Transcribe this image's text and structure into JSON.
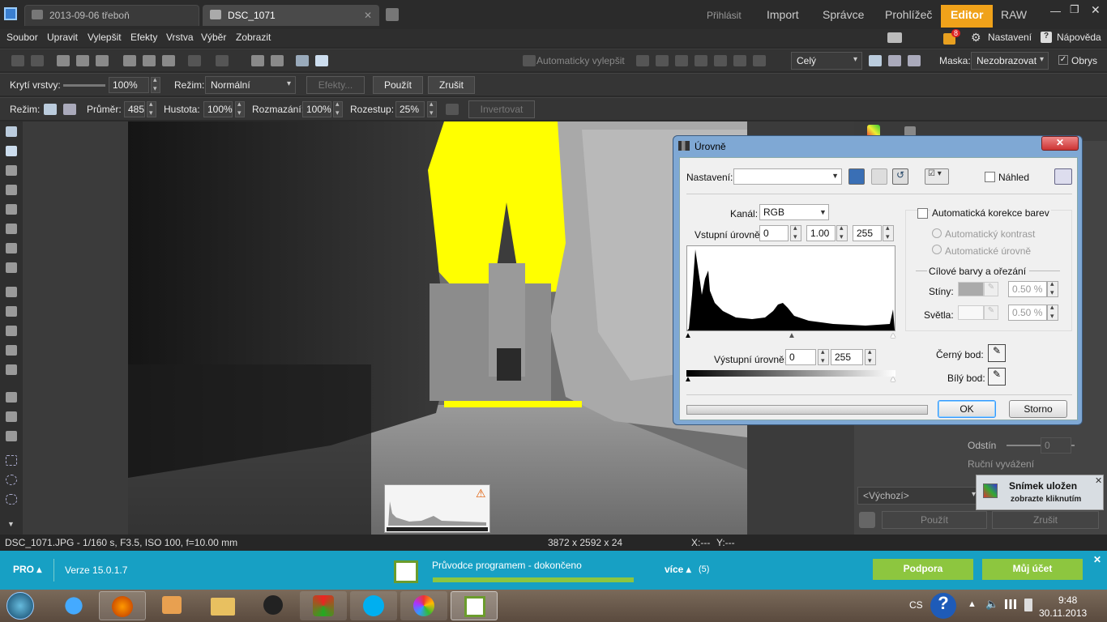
{
  "tabs": [
    {
      "label": "2013-09-06 třeboň"
    },
    {
      "label": "DSC_1071"
    }
  ],
  "nav": {
    "signin": "Přihlásit",
    "import": "Import",
    "manager": "Správce",
    "viewer": "Prohlížeč",
    "editor": "Editor",
    "raw": "RAW"
  },
  "menu": {
    "items": [
      "Soubor",
      "Upravit",
      "Vylepšit",
      "Efekty",
      "Vrstva",
      "Výběr",
      "Zobrazit"
    ],
    "badge": "8",
    "settings": "Nastavení",
    "help": "Nápověda"
  },
  "toolbar1": {
    "autoenhance": "Automaticky vylepšit",
    "zoom": "Celý",
    "mask_label": "Maska:",
    "mask_value": "Nezobrazovat",
    "outline": "Obrys"
  },
  "toolbar2": {
    "opacity_label": "Krytí vrstvy:",
    "opacity": "100%",
    "mode_label": "Režim:",
    "mode": "Normální",
    "effects": "Efekty...",
    "apply": "Použít",
    "cancel": "Zrušit"
  },
  "toolbar3": {
    "mode_label": "Režim:",
    "diameter_label": "Průměr:",
    "diameter": "485",
    "density_label": "Hustota:",
    "density": "100%",
    "blur_label": "Rozmazání:",
    "blur": "100%",
    "spacing_label": "Rozestup:",
    "spacing": "25%",
    "invert": "Invertovat"
  },
  "status": {
    "file": "DSC_1071.JPG - 1/160 s, F3.5, ISO 100, f=10.00 mm",
    "dimensions": "3872 x 2592 x 24",
    "x": "X:---",
    "y": "Y:---"
  },
  "probar": {
    "pro": "PRO",
    "version": "Verze 15.0.1.7",
    "wizard": "Průvodce programem - dokončeno",
    "wizard_progress": 1.0,
    "more": "více",
    "more_count": "(5)",
    "support": "Podpora",
    "account": "Můj účet"
  },
  "taskbar": {
    "lang": "CS",
    "time": "9:48",
    "date": "30.11.2013"
  },
  "notification": {
    "title": "Snímek uložen",
    "subtitle": "zobrazte kliknutím"
  },
  "rightpanel": {
    "hue": "Odstín",
    "hue_value": "0",
    "manual_balance": "Ruční vyvážení",
    "preset": "<Výchozí>",
    "apply": "Použít",
    "cancel": "Zrušit"
  },
  "dialog": {
    "title": "Úrovně",
    "preset_label": "Nastavení:",
    "preview": "Náhled",
    "channel_label": "Kanál:",
    "channel": "RGB",
    "input_label": "Vstupní úrovně:",
    "input_black": "0",
    "input_gamma": "1.00",
    "input_white": "255",
    "output_label": "Výstupní úrovně:",
    "output_black": "0",
    "output_white": "255",
    "auto_color": "Automatická korekce barev",
    "auto_contrast": "Automatický kontrast",
    "auto_levels": "Automatické úrovně",
    "target_group": "Cílové barvy a ořezání",
    "shadows_label": "Stíny:",
    "shadows": "0.50 %",
    "highlights_label": "Světla:",
    "highlights": "0.50 %",
    "black_point": "Černý bod:",
    "white_point": "Bílý bod:",
    "ok": "OK",
    "cancel": "Storno"
  }
}
